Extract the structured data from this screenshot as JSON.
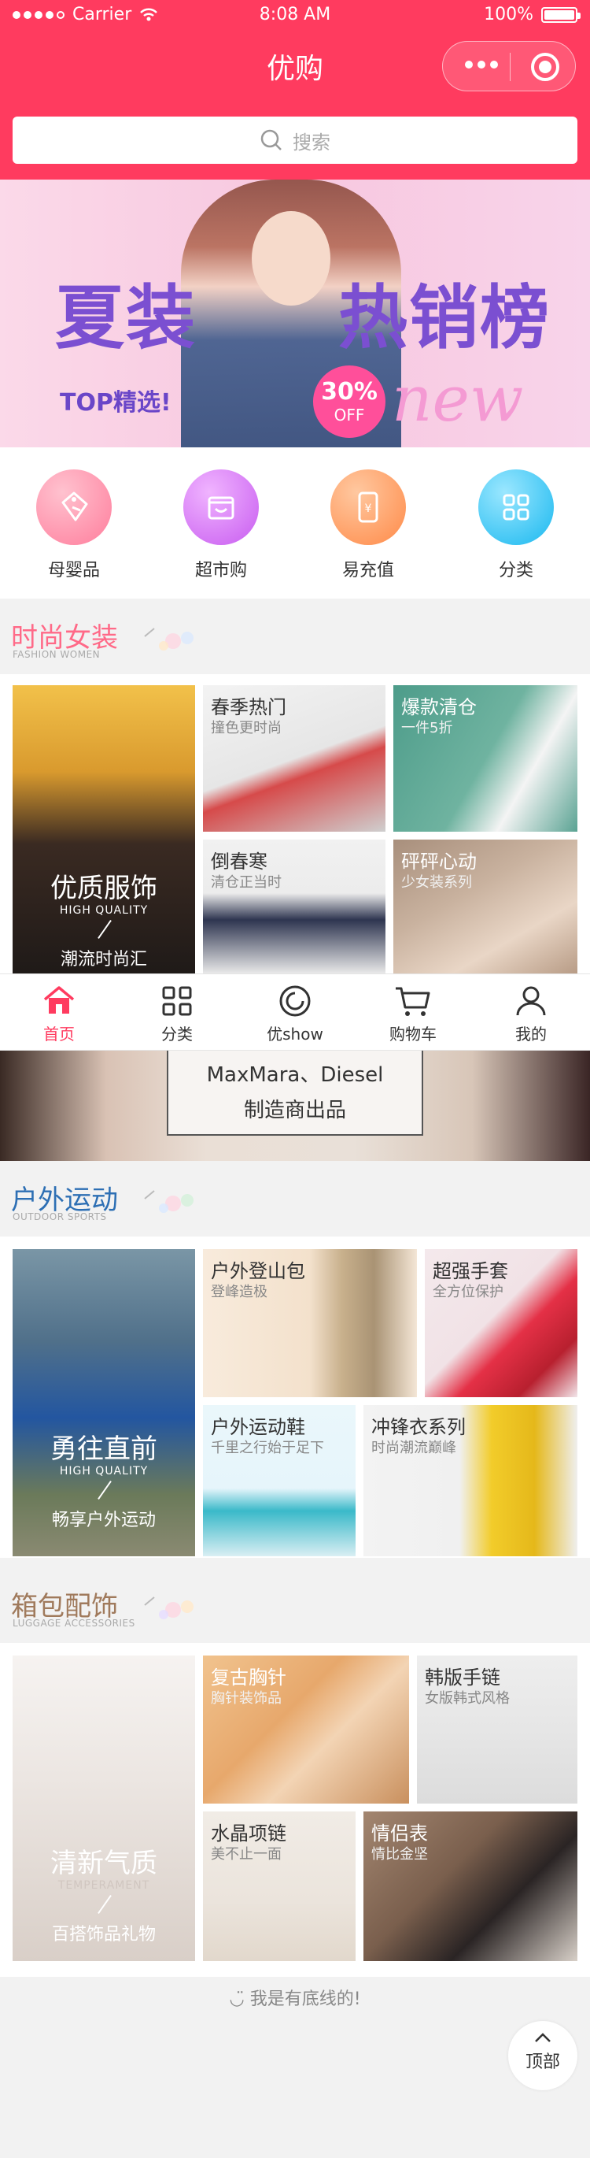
{
  "status": {
    "carrier": "Carrier",
    "time": "8:08 AM",
    "battery": "100%"
  },
  "nav": {
    "title": "优购"
  },
  "search": {
    "placeholder": "搜索"
  },
  "banner": {
    "title_left": "夏装",
    "title_right": "热销榜",
    "sub": "TOP精选!",
    "badge_pct": "30%",
    "badge_off": "OFF",
    "script": "new"
  },
  "categories": [
    {
      "label": "母婴品",
      "icon": "baby-tag-icon",
      "color": "#ff8fa9"
    },
    {
      "label": "超市购",
      "icon": "store-icon",
      "color": "#d176f5"
    },
    {
      "label": "易充值",
      "icon": "phone-recharge-icon",
      "color": "#ff9a5c"
    },
    {
      "label": "分类",
      "icon": "grid-icon",
      "color": "#25c3f5"
    }
  ],
  "sections": {
    "fashion": {
      "title": "时尚女装",
      "sub": "FASHION WOMEN",
      "title_color": "#ff6a88",
      "big": {
        "line1": "优质服饰",
        "line2": "HIGH QUALITY",
        "line3": "潮流时尚汇"
      },
      "tiles": [
        {
          "title": "春季热门",
          "sub": "撞色更时尚"
        },
        {
          "title": "爆款清仓",
          "sub": "一件5折"
        },
        {
          "title": "倒春寒",
          "sub": "清仓正当时"
        },
        {
          "title": "砰砰心动",
          "sub": "少女装系列"
        }
      ]
    },
    "outdoor": {
      "title": "户外运动",
      "sub": "OUTDOOR SPORTS",
      "title_color": "#2d6fb4",
      "big": {
        "line1": "勇往直前",
        "line2": "HIGH QUALITY",
        "line3": "畅享户外运动"
      },
      "tiles": [
        {
          "title": "户外登山包",
          "sub": "登峰造极"
        },
        {
          "title": "超强手套",
          "sub": "全方位保护"
        },
        {
          "title": "户外运动鞋",
          "sub": "千里之行始于足下"
        },
        {
          "title": "冲锋衣系列",
          "sub": "时尚潮流巅峰"
        }
      ]
    },
    "bags": {
      "title": "箱包配饰",
      "sub": "LUGGAGE ACCESSORIES",
      "title_color": "#a07a5c",
      "big": {
        "line1": "清新气质",
        "line2": "TEMPERAMENT",
        "line3": "百搭饰品礼物"
      },
      "tiles": [
        {
          "title": "复古胸针",
          "sub": "胸针装饰品"
        },
        {
          "title": "韩版手链",
          "sub": "女版韩式风格"
        },
        {
          "title": "水晶项链",
          "sub": "美不止一面"
        },
        {
          "title": "情侣表",
          "sub": "情比金坚"
        }
      ]
    }
  },
  "tabbar": [
    {
      "label": "首页",
      "icon": "home-icon"
    },
    {
      "label": "分类",
      "icon": "grid-icon"
    },
    {
      "label": "优show",
      "icon": "refresh-icon"
    },
    {
      "label": "购物车",
      "icon": "cart-icon"
    },
    {
      "label": "我的",
      "icon": "user-icon"
    }
  ],
  "strip": {
    "line1": "MaxMara、Diesel",
    "line2": "制造商出品"
  },
  "footer": {
    "message": "我是有底线的!",
    "totop": "顶部"
  },
  "colors": {
    "brand": "#ff3b5f",
    "active_tab": "#ff3b5f"
  }
}
